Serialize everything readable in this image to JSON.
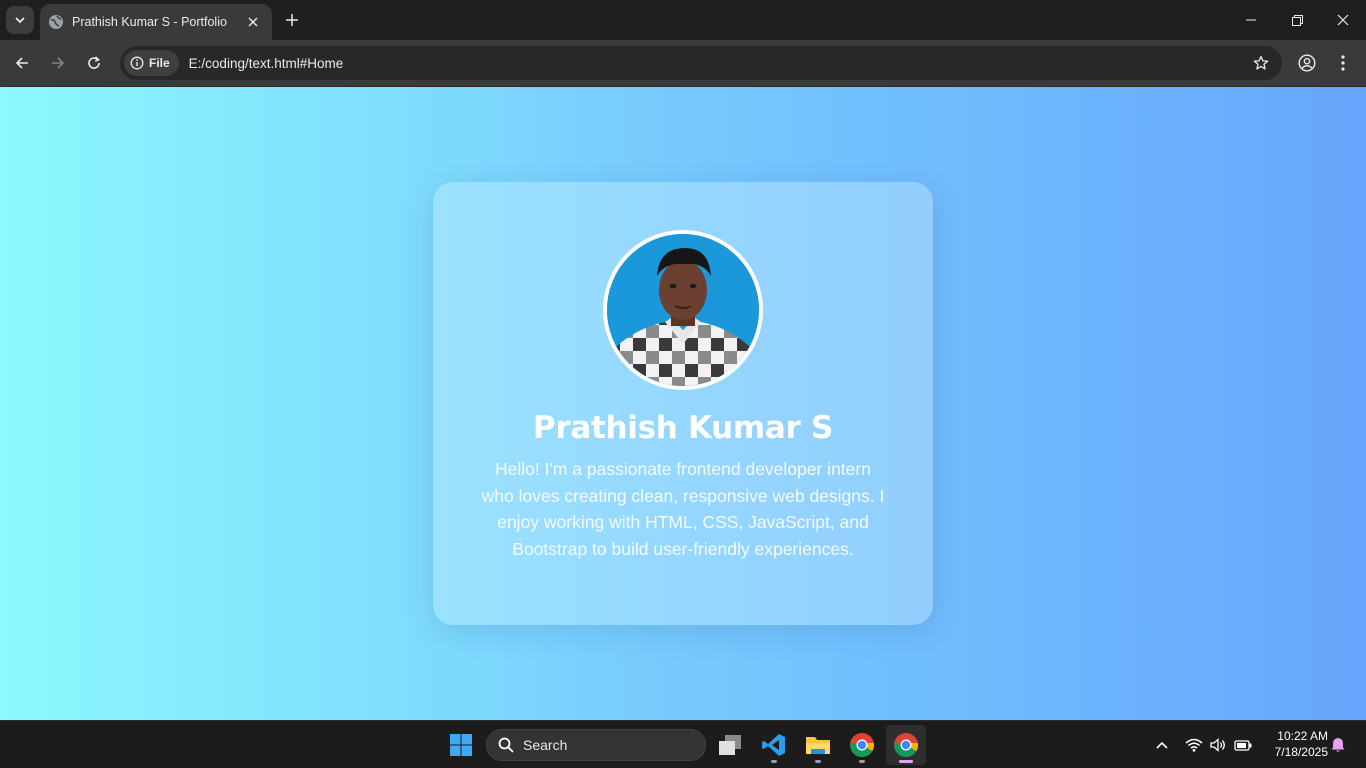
{
  "browser": {
    "tab": {
      "title": "Prathish Kumar S - Portfolio"
    },
    "address": {
      "chip_label": "File",
      "url": "E:/coding/text.html#Home"
    }
  },
  "page": {
    "name": "Prathish Kumar S",
    "bio": "Hello! I'm a passionate frontend developer intern who loves creating clean, responsive web designs. I enjoy working with HTML, CSS, JavaScript, and Bootstrap to build user-friendly experiences."
  },
  "taskbar": {
    "search_label": "Search",
    "apps": [
      "task-view",
      "vs-code",
      "file-explorer",
      "chrome",
      "chrome"
    ]
  },
  "clock": {
    "time": "10:22 AM",
    "date": "7/18/2025"
  },
  "colors": {
    "gradient_start": "#8cf9fd",
    "gradient_end": "#66a6fd",
    "card": "#a8dcfd",
    "taskbar": "#1c1c1c",
    "browser_frame": "#1f1f1f"
  }
}
